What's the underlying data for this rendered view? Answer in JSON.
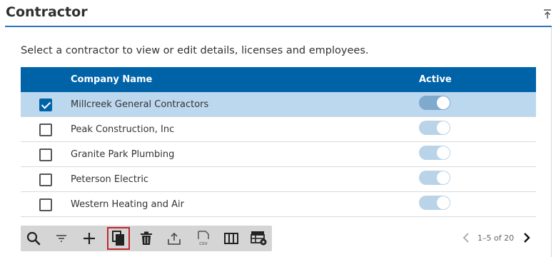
{
  "header": {
    "title": "Contractor"
  },
  "instructions": "Select a contractor to view or edit details, licenses and employees.",
  "table": {
    "columns": {
      "name": "Company Name",
      "active": "Active"
    },
    "rows": [
      {
        "name": "Millcreek General Contractors",
        "selected": true,
        "active": true
      },
      {
        "name": "Peak Construction, Inc",
        "selected": false,
        "active": true
      },
      {
        "name": "Granite Park Plumbing",
        "selected": false,
        "active": true
      },
      {
        "name": "Peterson Electric",
        "selected": false,
        "active": true
      },
      {
        "name": "Western Heating and Air",
        "selected": false,
        "active": true
      }
    ]
  },
  "toolbar": {
    "icons": [
      "search-icon",
      "filter-icon",
      "add-icon",
      "copy-icon",
      "delete-icon",
      "upload-icon",
      "csv-export-icon",
      "columns-icon",
      "table-settings-icon"
    ],
    "highlighted": "copy-icon"
  },
  "pager": {
    "range_text": "1–5 of 20"
  },
  "colors": {
    "header_bg": "#0063a8",
    "selected_row": "#bcd8ef",
    "toolbar_bg": "#d5d5d5",
    "accent_rule": "#2a75b9",
    "highlight_border": "#c1272d"
  }
}
